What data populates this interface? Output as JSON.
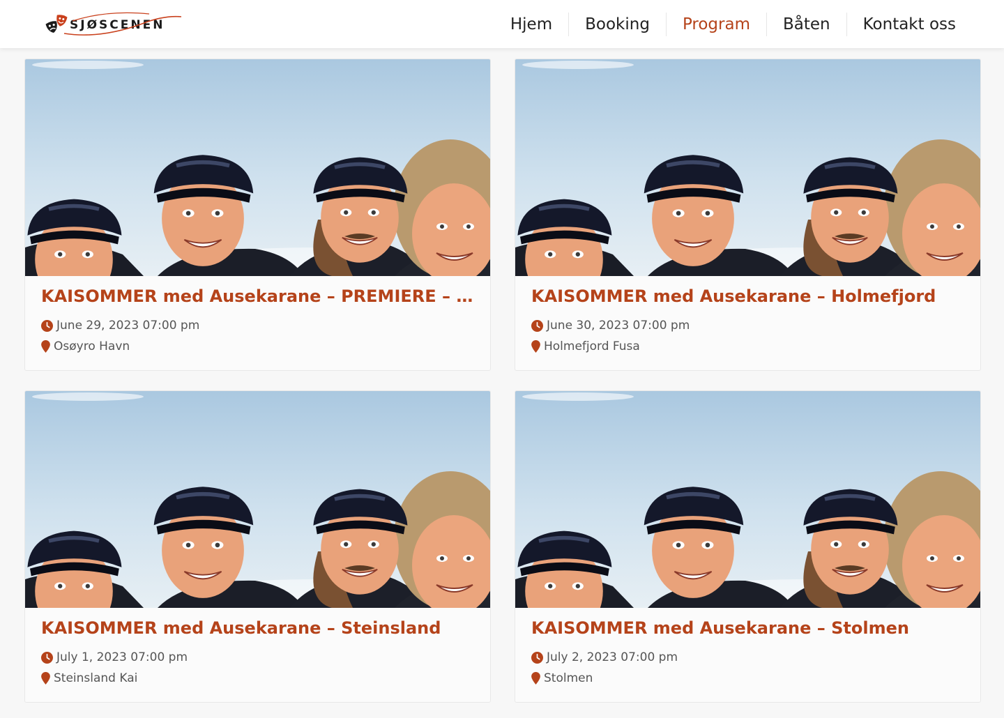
{
  "brand": {
    "name": "SJØSCENEN",
    "accent_color": "#b5431a",
    "logo_icon": "theater-masks-icon"
  },
  "nav": {
    "items": [
      {
        "label": "Hjem",
        "active": false
      },
      {
        "label": "Booking",
        "active": false
      },
      {
        "label": "Program",
        "active": true
      },
      {
        "label": "Båten",
        "active": false
      },
      {
        "label": "Kontakt oss",
        "active": false
      }
    ]
  },
  "events": [
    {
      "title": "KAISOMMER med Ausekarane – PREMIERE – OS…",
      "datetime": "June 29, 2023 07:00 pm",
      "location": "Osøyro Havn",
      "image": "band-photo"
    },
    {
      "title": "KAISOMMER med Ausekarane – Holmefjord",
      "datetime": "June 30, 2023 07:00 pm",
      "location": "Holmefjord Fusa",
      "image": "band-photo"
    },
    {
      "title": "KAISOMMER med Ausekarane – Steinsland",
      "datetime": "July 1, 2023 07:00 pm",
      "location": "Steinsland Kai",
      "image": "band-photo"
    },
    {
      "title": "KAISOMMER med Ausekarane – Stolmen",
      "datetime": "July 2, 2023 07:00 pm",
      "location": "Stolmen",
      "image": "band-photo"
    }
  ],
  "icons": {
    "clock": "clock-icon",
    "location": "map-marker-icon"
  }
}
